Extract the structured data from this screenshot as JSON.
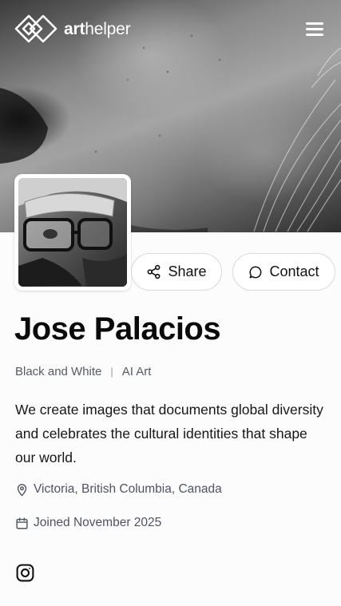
{
  "header": {
    "logo_text_bold": "art",
    "logo_text_light": "helper",
    "menu_icon": "hamburger-menu-icon"
  },
  "profile": {
    "name": "Jose Palacios",
    "tags": [
      "Black and White",
      "AI Art"
    ],
    "tag_separator": "|",
    "bio": "We create images that documents global diversity and celebrates the cultural identities that shape our world.",
    "location": "Victoria, British Columbia, Canada",
    "joined": "Joined November 2025"
  },
  "actions": {
    "share_label": "Share",
    "contact_label": "Contact"
  },
  "social": {
    "icons": [
      "instagram-icon"
    ]
  },
  "colors": {
    "background": "#fdfcfd",
    "text_primary": "#0a0a0a",
    "text_secondary": "#555a66",
    "button_border": "#d9d9de"
  }
}
